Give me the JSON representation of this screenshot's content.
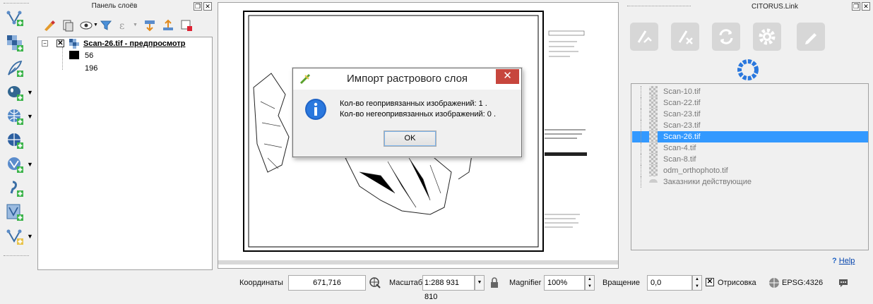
{
  "layers_panel": {
    "title": "Панель слоёв",
    "layer": {
      "name": "Scan-26.tif - предпросмотр",
      "legend": [
        "56",
        "196"
      ]
    }
  },
  "dialog": {
    "title": "Импорт растрового слоя",
    "close_glyph": "✕",
    "line1": "Кол-во геопривязанных изображений: 1 .",
    "line2": "Кол-во негеопривязанных изображений: 0 .",
    "ok_label": "OK"
  },
  "citorus": {
    "title": "CITORUS.Link",
    "items": [
      {
        "label": "Scan-10.tif",
        "selected": false
      },
      {
        "label": "Scan-22.tif",
        "selected": false
      },
      {
        "label": "Scan-23.tif",
        "selected": false
      },
      {
        "label": "Scan-23.tif",
        "selected": false
      },
      {
        "label": "Scan-26.tif",
        "selected": true
      },
      {
        "label": "Scan-4.tif",
        "selected": false
      },
      {
        "label": "Scan-8.tif",
        "selected": false
      },
      {
        "label": "odm_orthophoto.tif",
        "selected": false
      },
      {
        "label": "Заказники действующие",
        "selected": false
      }
    ],
    "help_label": "Help",
    "help_mark": "?"
  },
  "status_bar": {
    "coords_label": "Координаты",
    "coords_value": "671,716",
    "scale_label": "Масштаб",
    "scale_value": "1:288 931 810",
    "magnifier_label": "Magnifier",
    "magnifier_value": "100%",
    "rotation_label": "Вращение",
    "rotation_value": "0,0",
    "render_label": "Отрисовка",
    "crs_label": "EPSG:4326"
  },
  "colors": {
    "selection": "#3399ff",
    "close_red": "#c7463d",
    "info_blue": "#1f63c6"
  }
}
